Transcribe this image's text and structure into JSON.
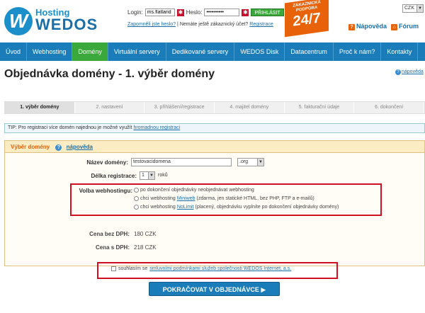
{
  "header": {
    "logo_hosting": "Hosting",
    "logo_wedos": "WEDOS",
    "login_label": "Login:",
    "login_value": "ms.flatland",
    "password_label": "Heslo:",
    "password_value": "••••••••••",
    "login_button": "PŘIHLÁSIT",
    "forgot_password": "Zapomněli jste heslo?",
    "no_account_text": "Nemáte ještě zákaznický účet?",
    "register_link": "Registrace",
    "badge_line1": "ZÁKAZNICKÁ PODPORA",
    "badge_line2": "24/7",
    "lang_value": "CZK",
    "help_link": "Nápověda",
    "forum_link": "Fórum"
  },
  "nav": {
    "items": [
      {
        "label": "Úvod"
      },
      {
        "label": "Webhosting"
      },
      {
        "label": "Domény"
      },
      {
        "label": "Virtuální servery"
      },
      {
        "label": "Dedikované servery"
      },
      {
        "label": "WEDOS Disk"
      },
      {
        "label": "Datacentrum"
      },
      {
        "label": "Proč k nám?"
      },
      {
        "label": "Kontakty"
      }
    ],
    "active_index": 2
  },
  "page": {
    "title": "Objednávka domény - 1. výběr domény",
    "help_link": "nápověda"
  },
  "steps": [
    {
      "label": "1. výběr domény"
    },
    {
      "label": "2. nastavení"
    },
    {
      "label": "3. přihlášení/registrace"
    },
    {
      "label": "4. majitel domény"
    },
    {
      "label": "5. fakturační údaje"
    },
    {
      "label": "6. dokončení"
    }
  ],
  "tip": {
    "text": "TIP: Pro registraci více domén najednou je možné využít",
    "link": "hromadnou registraci"
  },
  "panel": {
    "title": "Výběr domény",
    "help_link": "nápověda",
    "domain_label": "Název domény:",
    "domain_value": "testovacidomena",
    "tld_value": ".org",
    "length_label": "Délka registrace:",
    "length_value": "1",
    "length_unit": "roků",
    "webhosting_label": "Volba webhostingu:",
    "webhosting_options": [
      {
        "text": "po dokončení objednávky neobjednávat webhosting",
        "link": "",
        "rest": ""
      },
      {
        "text": "chci webhosting ",
        "link": "Miniweb",
        "rest": " (zdarma, jen statické HTML, bez PHP, FTP a e-mailů)"
      },
      {
        "text": "chci webhosting ",
        "link": "NoLimit",
        "rest": " (placený, objednávku vyplníte po dokončení objednávky domény)"
      }
    ],
    "price_no_vat_label": "Cena bez DPH:",
    "price_no_vat_value": "180 CZK",
    "price_vat_label": "Cena s DPH:",
    "price_vat_value": "218 CZK"
  },
  "agree": {
    "text": "souhlasím se",
    "link": "smluvními podmínkami služeb společnosti WEDOS Internet, a.s."
  },
  "continue_button": "POKRAČOVAT V OBJEDNÁVCE ▶",
  "colors": {
    "nav_bg": "#1a7cb8",
    "nav_active": "#3aa83a",
    "accent_orange": "#e8620a",
    "highlight_red": "#d01020"
  }
}
